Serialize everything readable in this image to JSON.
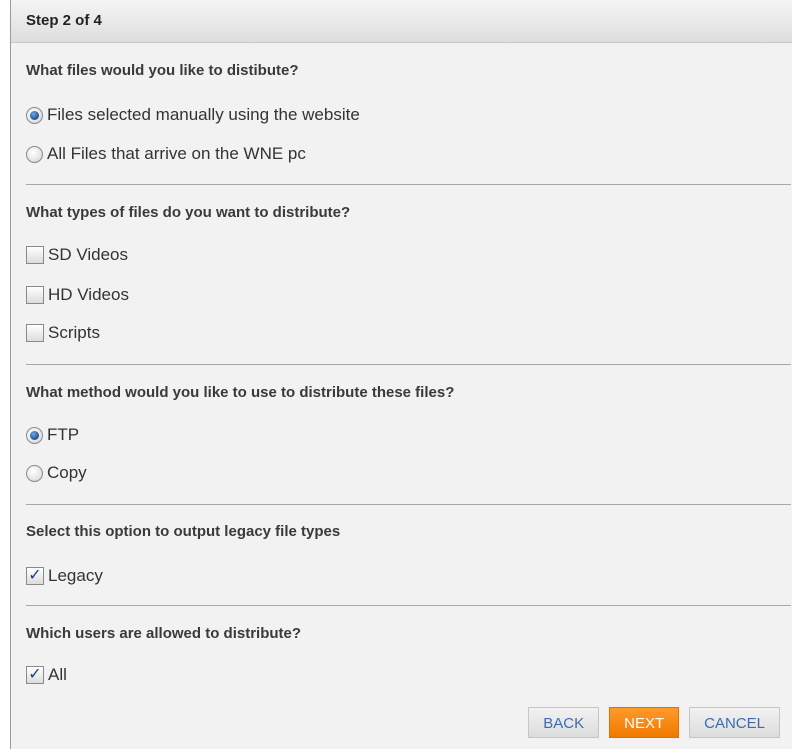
{
  "header": {
    "step_title": "Step 2 of 4"
  },
  "sections": {
    "files": {
      "question": "What files would you like to distibute?",
      "options": [
        {
          "label": "Files selected manually using the website",
          "checked": true
        },
        {
          "label": "All Files that arrive on the WNE pc",
          "checked": false
        }
      ]
    },
    "types": {
      "question": "What types of files do you want to distribute?",
      "options": [
        {
          "label": "SD Videos",
          "checked": false
        },
        {
          "label": "HD Videos",
          "checked": false
        },
        {
          "label": "Scripts",
          "checked": false
        }
      ]
    },
    "method": {
      "question": "What method would you like to use to distribute these files?",
      "options": [
        {
          "label": "FTP",
          "checked": true
        },
        {
          "label": "Copy",
          "checked": false
        }
      ]
    },
    "legacy": {
      "question": "Select this option to output legacy file types",
      "options": [
        {
          "label": "Legacy",
          "checked": true
        }
      ]
    },
    "users": {
      "question": "Which users are allowed to distribute?",
      "options": [
        {
          "label": "All",
          "checked": true
        }
      ]
    }
  },
  "footer": {
    "back_label": "BACK",
    "next_label": "NEXT",
    "cancel_label": "CANCEL"
  },
  "colors": {
    "accent_primary": "#f58a12",
    "link_blue": "#3d6cae",
    "radio_selected": "#1f4f8f"
  }
}
